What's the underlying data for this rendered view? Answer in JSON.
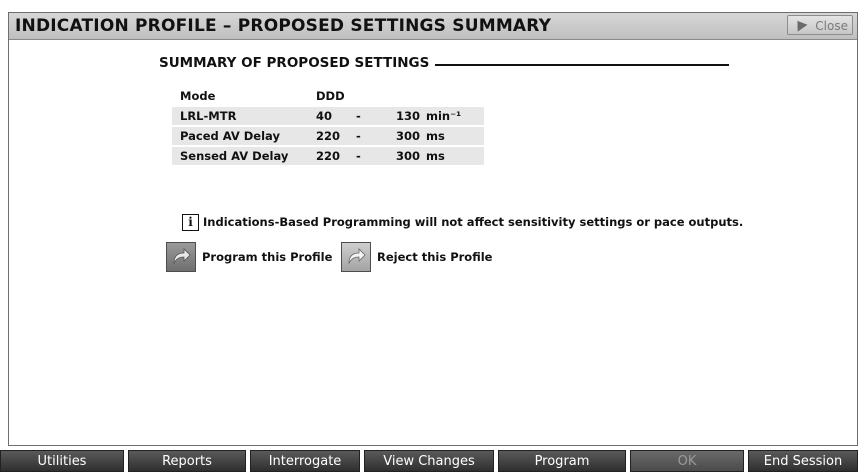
{
  "window": {
    "title": "INDICATION PROFILE – PROPOSED SETTINGS SUMMARY",
    "close_label": "Close"
  },
  "summary": {
    "heading": "SUMMARY OF PROPOSED SETTINGS",
    "rows": [
      {
        "name": "Mode",
        "low": "DDD",
        "dash": "",
        "high": "",
        "unit": ""
      },
      {
        "name": "LRL-MTR",
        "low": "40",
        "dash": "-",
        "high": "130",
        "unit": "min⁻¹"
      },
      {
        "name": "Paced AV Delay",
        "low": "220",
        "dash": "-",
        "high": "300",
        "unit": "ms"
      },
      {
        "name": "Sensed AV Delay",
        "low": "220",
        "dash": "-",
        "high": "300",
        "unit": "ms"
      }
    ]
  },
  "info": {
    "icon": "info-icon",
    "text": "Indications-Based Programming will not affect sensitivity settings or pace outputs."
  },
  "actions": {
    "program_label": "Program this Profile",
    "reject_label": "Reject this Profile"
  },
  "bottom_bar": {
    "tabs": [
      {
        "label": "Utilities",
        "enabled": true
      },
      {
        "label": "Reports",
        "enabled": true
      },
      {
        "label": "Interrogate",
        "enabled": true
      },
      {
        "label": "View Changes",
        "enabled": true
      },
      {
        "label": "Program",
        "enabled": true
      },
      {
        "label": "OK",
        "enabled": false
      },
      {
        "label": "End Session",
        "enabled": true
      }
    ]
  }
}
